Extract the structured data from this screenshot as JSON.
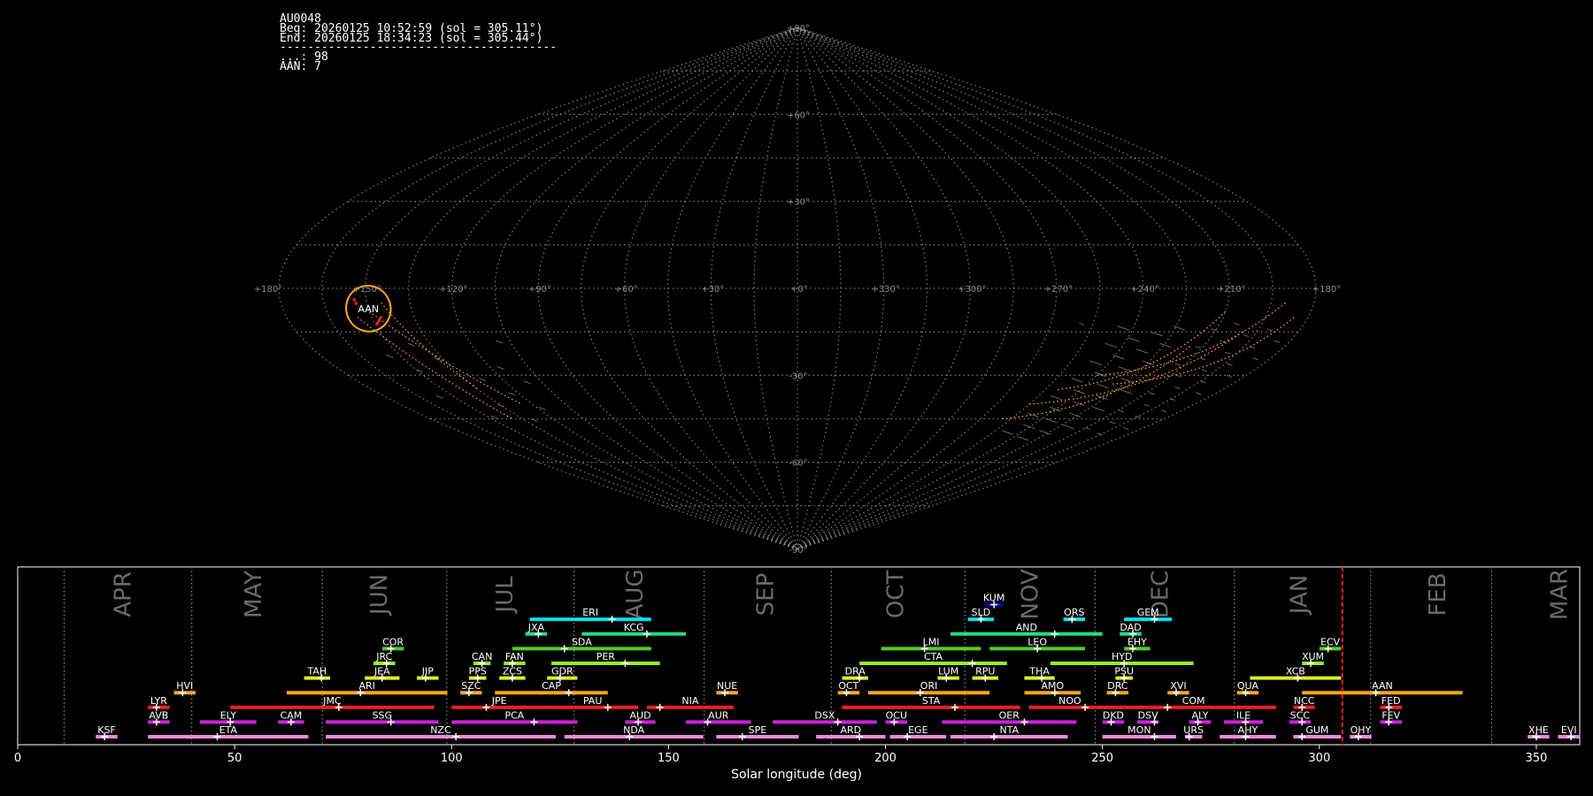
{
  "header": {
    "lines": [
      "AU0048",
      "Beg: 20260125 10:52:59 (sol = 305.11°)",
      "End: 20260125 18:34:23 (sol = 305.44°)",
      "----------------------------------------",
      "...: 98",
      "AAN: 7"
    ]
  },
  "colors": {
    "background": "#000000",
    "grid": "#9a9a9a",
    "meteor_track": "#b8b8b8",
    "shower_highlight": "#ffa51e",
    "current_marker": "#ff1a1a",
    "month_label": "#6a6a6a"
  },
  "sky_map": {
    "projection": "sinusoidal",
    "lon_labels": [
      "+180°",
      "+150°",
      "+120°",
      "+90°",
      "+60°",
      "+30°",
      "+0°",
      "+330°",
      "+300°",
      "+270°",
      "+240°",
      "+210°",
      "+180°"
    ],
    "lon_values": [
      180,
      150,
      120,
      90,
      60,
      30,
      0,
      -30,
      -60,
      -90,
      -120,
      -150,
      -180
    ],
    "lat_labels": [
      "+90°",
      "+60°",
      "+30°",
      "-30°",
      "-60°",
      "-90°"
    ],
    "lat_values": [
      90,
      60,
      30,
      -30,
      -60,
      -90
    ],
    "highlight": {
      "label": "AAN",
      "lon": 150,
      "lat": -7,
      "rx_deg": 8,
      "ry_deg": 10
    }
  },
  "chart_data": {
    "type": "timeline",
    "xlabel": "Solar longitude (deg)",
    "xlim": [
      0,
      360
    ],
    "xticks": [
      0,
      50,
      100,
      150,
      200,
      250,
      300,
      350
    ],
    "current_sol": 305.3,
    "month_boundaries": [
      10.7,
      40.1,
      70.2,
      98.9,
      128.2,
      158.2,
      187.5,
      218.3,
      248.3,
      280.4,
      311.8,
      339.7
    ],
    "months": [
      {
        "label": "APR",
        "sol": 24
      },
      {
        "label": "MAY",
        "sol": 54
      },
      {
        "label": "JUN",
        "sol": 83
      },
      {
        "label": "JUL",
        "sol": 112
      },
      {
        "label": "AUG",
        "sol": 142
      },
      {
        "label": "SEP",
        "sol": 172
      },
      {
        "label": "OCT",
        "sol": 202
      },
      {
        "label": "NOV",
        "sol": 233
      },
      {
        "label": "DEC",
        "sol": 263
      },
      {
        "label": "JAN",
        "sol": 295
      },
      {
        "label": "FEB",
        "sol": 327
      },
      {
        "label": "MAR",
        "sol": 355
      }
    ],
    "showers": [
      {
        "code": "KUM",
        "start": 223,
        "end": 227,
        "peak": 225,
        "row": 9,
        "color": "#0000cc"
      },
      {
        "code": "ERI",
        "start": 118,
        "end": 146,
        "peak": 137,
        "row": 8,
        "color": "#00e5ee"
      },
      {
        "code": "SLD",
        "start": 219,
        "end": 225,
        "peak": 222,
        "row": 8,
        "color": "#00e5ee"
      },
      {
        "code": "ORS",
        "start": 241,
        "end": 246,
        "peak": 243,
        "row": 8,
        "color": "#00e5ee"
      },
      {
        "code": "GEM",
        "start": 255,
        "end": 266,
        "peak": 262,
        "row": 8,
        "color": "#00e5ee"
      },
      {
        "code": "JXA",
        "start": 117,
        "end": 122,
        "peak": 120,
        "row": 7,
        "color": "#22dd88"
      },
      {
        "code": "KCG",
        "start": 130,
        "end": 154,
        "peak": 145,
        "row": 7,
        "color": "#22dd88"
      },
      {
        "code": "AND",
        "start": 215,
        "end": 250,
        "peak": 239,
        "row": 7,
        "color": "#22dd88"
      },
      {
        "code": "DAD",
        "start": 254,
        "end": 259,
        "peak": 257,
        "row": 7,
        "color": "#22dd88"
      },
      {
        "code": "COR",
        "start": 84,
        "end": 89,
        "peak": 86,
        "row": 6,
        "color": "#55cc22"
      },
      {
        "code": "SDA",
        "start": 114,
        "end": 146,
        "peak": 126,
        "row": 6,
        "color": "#55cc22"
      },
      {
        "code": "LMI",
        "start": 199,
        "end": 222,
        "peak": 209,
        "row": 6,
        "color": "#55cc22"
      },
      {
        "code": "LEO",
        "start": 224,
        "end": 246,
        "peak": 235,
        "row": 6,
        "color": "#55cc22"
      },
      {
        "code": "EHY",
        "start": 255,
        "end": 261,
        "peak": 257,
        "row": 6,
        "color": "#55cc22"
      },
      {
        "code": "ECV",
        "start": 300,
        "end": 305,
        "peak": 302,
        "row": 6,
        "color": "#55cc22"
      },
      {
        "code": "JRC",
        "start": 82,
        "end": 87,
        "peak": 85,
        "row": 5,
        "color": "#99ee22"
      },
      {
        "code": "CAN",
        "start": 105,
        "end": 109,
        "peak": 107,
        "row": 5,
        "color": "#99ee22"
      },
      {
        "code": "FAN",
        "start": 112,
        "end": 117,
        "peak": 114,
        "row": 5,
        "color": "#99ee22"
      },
      {
        "code": "PER",
        "start": 123,
        "end": 148,
        "peak": 140,
        "row": 5,
        "color": "#99ee22"
      },
      {
        "code": "CTA",
        "start": 194,
        "end": 228,
        "peak": 220,
        "row": 5,
        "color": "#99ee22"
      },
      {
        "code": "HYD",
        "start": 238,
        "end": 271,
        "peak": 255,
        "row": 5,
        "color": "#99ee22"
      },
      {
        "code": "XUM",
        "start": 296,
        "end": 301,
        "peak": 298,
        "row": 5,
        "color": "#99ee22"
      },
      {
        "code": "TAH",
        "start": 66,
        "end": 72,
        "peak": 70,
        "row": 4,
        "color": "#ddee22"
      },
      {
        "code": "JEA",
        "start": 80,
        "end": 88,
        "peak": 84,
        "row": 4,
        "color": "#ddee22"
      },
      {
        "code": "JIP",
        "start": 92,
        "end": 97,
        "peak": 94,
        "row": 4,
        "color": "#ddee22"
      },
      {
        "code": "PPS",
        "start": 104,
        "end": 108,
        "peak": 106,
        "row": 4,
        "color": "#ddee22"
      },
      {
        "code": "ZCS",
        "start": 111,
        "end": 117,
        "peak": 114,
        "row": 4,
        "color": "#ddee22"
      },
      {
        "code": "GDR",
        "start": 122,
        "end": 129,
        "peak": 125,
        "row": 4,
        "color": "#ddee22"
      },
      {
        "code": "DRA",
        "start": 190,
        "end": 196,
        "peak": 194,
        "row": 4,
        "color": "#ddee22"
      },
      {
        "code": "LUM",
        "start": 212,
        "end": 217,
        "peak": 214,
        "row": 4,
        "color": "#ddee22"
      },
      {
        "code": "RPU",
        "start": 220,
        "end": 226,
        "peak": 223,
        "row": 4,
        "color": "#ddee22"
      },
      {
        "code": "THA",
        "start": 232,
        "end": 239,
        "peak": 236,
        "row": 4,
        "color": "#ddee22"
      },
      {
        "code": "PSU",
        "start": 253,
        "end": 257,
        "peak": 255,
        "row": 4,
        "color": "#ddee22"
      },
      {
        "code": "XCB",
        "start": 284,
        "end": 305,
        "peak": 295,
        "row": 4,
        "color": "#ddee22"
      },
      {
        "code": "HVI",
        "start": 36,
        "end": 41,
        "peak": 38,
        "row": 3,
        "color": "#ffa51e"
      },
      {
        "code": "ARI",
        "start": 62,
        "end": 99,
        "peak": 79,
        "row": 3,
        "color": "#ffa51e"
      },
      {
        "code": "SZC",
        "start": 102,
        "end": 107,
        "peak": 104,
        "row": 3,
        "color": "#ffa51e"
      },
      {
        "code": "CAP",
        "start": 110,
        "end": 136,
        "peak": 127,
        "row": 3,
        "color": "#ffa51e"
      },
      {
        "code": "NUE",
        "start": 161,
        "end": 166,
        "peak": 163,
        "row": 3,
        "color": "#ffa51e"
      },
      {
        "code": "OCT",
        "start": 189,
        "end": 194,
        "peak": 191,
        "row": 3,
        "color": "#ffa51e"
      },
      {
        "code": "ORI",
        "start": 196,
        "end": 224,
        "peak": 208,
        "row": 3,
        "color": "#ffa51e"
      },
      {
        "code": "AMO",
        "start": 232,
        "end": 245,
        "peak": 239,
        "row": 3,
        "color": "#ffa51e"
      },
      {
        "code": "DRC",
        "start": 251,
        "end": 256,
        "peak": 253,
        "row": 3,
        "color": "#ffa51e"
      },
      {
        "code": "XVI",
        "start": 265,
        "end": 270,
        "peak": 267,
        "row": 3,
        "color": "#ffa51e"
      },
      {
        "code": "QUA",
        "start": 281,
        "end": 286,
        "peak": 283,
        "row": 3,
        "color": "#ffa51e"
      },
      {
        "code": "AAN",
        "start": 296,
        "end": 333,
        "peak": 313,
        "row": 3,
        "color": "#ffa51e"
      },
      {
        "code": "LYR",
        "start": 30,
        "end": 35,
        "peak": 32,
        "row": 2,
        "color": "#ee2020"
      },
      {
        "code": "JMC",
        "start": 49,
        "end": 96,
        "peak": 74,
        "row": 2,
        "color": "#ee2020"
      },
      {
        "code": "JPE",
        "start": 100,
        "end": 122,
        "peak": 108,
        "row": 2,
        "color": "#ee2020"
      },
      {
        "code": "PAU",
        "start": 122,
        "end": 143,
        "peak": 136,
        "row": 2,
        "color": "#ee2020"
      },
      {
        "code": "NIA",
        "start": 145,
        "end": 165,
        "peak": 148,
        "row": 2,
        "color": "#ee2020"
      },
      {
        "code": "STA",
        "start": 190,
        "end": 231,
        "peak": 216,
        "row": 2,
        "color": "#ee2020"
      },
      {
        "code": "NOO",
        "start": 233,
        "end": 252,
        "peak": 246,
        "row": 2,
        "color": "#ee2020"
      },
      {
        "code": "COM",
        "start": 252,
        "end": 290,
        "peak": 265,
        "row": 2,
        "color": "#ee2020"
      },
      {
        "code": "NCC",
        "start": 294,
        "end": 299,
        "peak": 296,
        "row": 2,
        "color": "#ee2020"
      },
      {
        "code": "FED",
        "start": 314,
        "end": 319,
        "peak": 316,
        "row": 2,
        "color": "#ee2020"
      },
      {
        "code": "AVB",
        "start": 30,
        "end": 35,
        "peak": 32,
        "row": 1,
        "color": "#cc22dd"
      },
      {
        "code": "ELY",
        "start": 42,
        "end": 55,
        "peak": 49,
        "row": 1,
        "color": "#cc22dd"
      },
      {
        "code": "CAM",
        "start": 60,
        "end": 66,
        "peak": 63,
        "row": 1,
        "color": "#cc22dd"
      },
      {
        "code": "SSG",
        "start": 71,
        "end": 97,
        "peak": 86,
        "row": 1,
        "color": "#cc22dd"
      },
      {
        "code": "PCA",
        "start": 100,
        "end": 129,
        "peak": 119,
        "row": 1,
        "color": "#cc22dd"
      },
      {
        "code": "AUD",
        "start": 140,
        "end": 147,
        "peak": 143,
        "row": 1,
        "color": "#cc22dd"
      },
      {
        "code": "AUR",
        "start": 154,
        "end": 169,
        "peak": 159,
        "row": 1,
        "color": "#cc22dd"
      },
      {
        "code": "DSX",
        "start": 174,
        "end": 198,
        "peak": 189,
        "row": 1,
        "color": "#cc22dd"
      },
      {
        "code": "OCU",
        "start": 200,
        "end": 205,
        "peak": 202,
        "row": 1,
        "color": "#cc22dd"
      },
      {
        "code": "OER",
        "start": 213,
        "end": 244,
        "peak": 232,
        "row": 1,
        "color": "#cc22dd"
      },
      {
        "code": "DKD",
        "start": 250,
        "end": 255,
        "peak": 252,
        "row": 1,
        "color": "#cc22dd"
      },
      {
        "code": "DSV",
        "start": 258,
        "end": 263,
        "peak": 262,
        "row": 1,
        "color": "#cc22dd"
      },
      {
        "code": "ALY",
        "start": 270,
        "end": 275,
        "peak": 272,
        "row": 1,
        "color": "#cc22dd"
      },
      {
        "code": "ILE",
        "start": 278,
        "end": 287,
        "peak": 283,
        "row": 1,
        "color": "#cc22dd"
      },
      {
        "code": "SCC",
        "start": 293,
        "end": 298,
        "peak": 296,
        "row": 1,
        "color": "#cc22dd"
      },
      {
        "code": "FEV",
        "start": 314,
        "end": 319,
        "peak": 316,
        "row": 1,
        "color": "#cc22dd"
      },
      {
        "code": "KSF",
        "start": 18,
        "end": 23,
        "peak": 20,
        "row": 0,
        "color": "#ee88dd"
      },
      {
        "code": "ETA",
        "start": 30,
        "end": 67,
        "peak": 46,
        "row": 0,
        "color": "#ee88dd"
      },
      {
        "code": "NZC",
        "start": 71,
        "end": 124,
        "peak": 101,
        "row": 0,
        "color": "#ee88dd"
      },
      {
        "code": "NDA",
        "start": 126,
        "end": 158,
        "peak": 141,
        "row": 0,
        "color": "#ee88dd"
      },
      {
        "code": "SPE",
        "start": 161,
        "end": 180,
        "peak": 167,
        "row": 0,
        "color": "#ee88dd"
      },
      {
        "code": "ARD",
        "start": 184,
        "end": 200,
        "peak": 194,
        "row": 0,
        "color": "#ee88dd"
      },
      {
        "code": "EGE",
        "start": 201,
        "end": 214,
        "peak": 205,
        "row": 0,
        "color": "#ee88dd"
      },
      {
        "code": "NTA",
        "start": 215,
        "end": 242,
        "peak": 225,
        "row": 0,
        "color": "#ee88dd"
      },
      {
        "code": "MON",
        "start": 250,
        "end": 267,
        "peak": 262,
        "row": 0,
        "color": "#ee88dd"
      },
      {
        "code": "URS",
        "start": 269,
        "end": 273,
        "peak": 270,
        "row": 0,
        "color": "#ee88dd"
      },
      {
        "code": "AHY",
        "start": 277,
        "end": 290,
        "peak": 283,
        "row": 0,
        "color": "#ee88dd"
      },
      {
        "code": "GUM",
        "start": 294,
        "end": 305,
        "peak": 296,
        "row": 0,
        "color": "#ee88dd"
      },
      {
        "code": "OHY",
        "start": 307,
        "end": 312,
        "peak": 309,
        "row": 0,
        "color": "#ee88dd"
      },
      {
        "code": "XHE",
        "start": 348,
        "end": 353,
        "peak": 350,
        "row": 0,
        "color": "#ee88dd"
      },
      {
        "code": "EVI",
        "start": 355,
        "end": 360,
        "peak": 358,
        "row": 0,
        "color": "#ee88dd"
      }
    ]
  }
}
